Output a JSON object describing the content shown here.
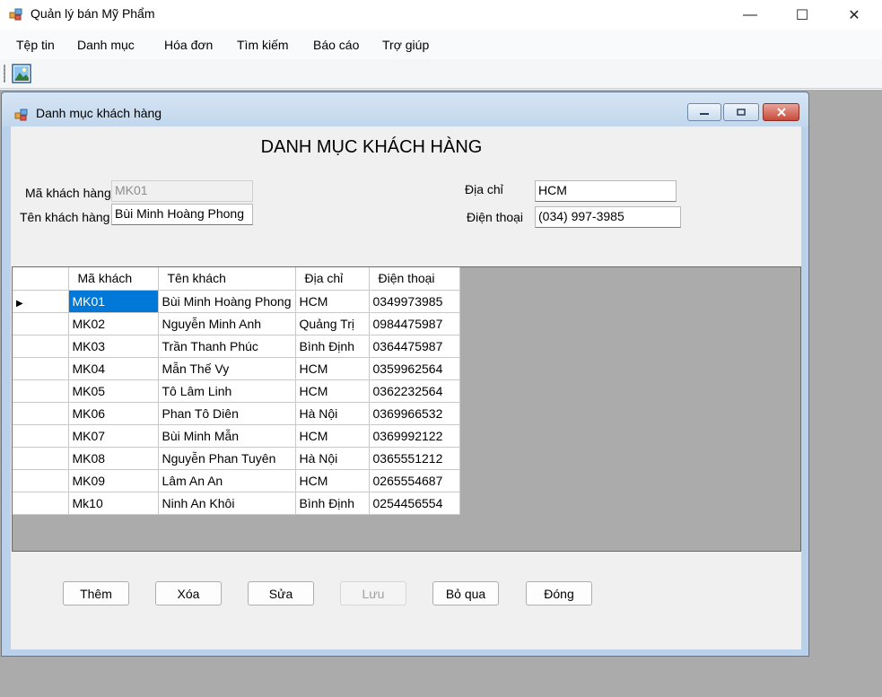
{
  "app": {
    "title": "Quản lý bán Mỹ Phẩm"
  },
  "window_controls": {
    "minimize": "—",
    "maximize": "☐",
    "close": "✕"
  },
  "menu": [
    "Tệp tin",
    "Danh mục",
    "Hóa đơn",
    "Tìm kiếm",
    "Báo cáo",
    "Trợ giúp"
  ],
  "toolbar": {
    "icons": [
      "picture-icon"
    ]
  },
  "child": {
    "title": "Danh mục khách hàng",
    "heading": "DANH MỤC KHÁCH HÀNG",
    "form": {
      "ma_label": "Mã khách hàng",
      "ma_value": "MK01",
      "ten_label": "Tên khách hàng",
      "ten_value": "Bùi Minh Hoàng Phong",
      "diachi_label": "Địa chỉ",
      "diachi_value": "HCM",
      "dienthoai_label": "Điện thoại",
      "dienthoai_value": "(034) 997-3985"
    },
    "grid": {
      "headers": [
        "Mã khách",
        "Tên khách",
        "Địa chỉ",
        "Điện thoại"
      ],
      "rows": [
        [
          "MK01",
          "Bùi Minh Hoàng Phong",
          "HCM",
          "0349973985"
        ],
        [
          "MK02",
          "Nguyễn Minh Anh",
          "Quảng Trị",
          "0984475987"
        ],
        [
          "MK03",
          "Trần Thanh Phúc",
          "Bình Định",
          "0364475987"
        ],
        [
          "MK04",
          "Mẫn Thế Vy",
          "HCM",
          "0359962564"
        ],
        [
          "MK05",
          "Tô Lâm Linh",
          "HCM",
          "0362232564"
        ],
        [
          "MK06",
          "Phan Tô Diên",
          "Hà Nội",
          "0369966532"
        ],
        [
          "MK07",
          "Bùi Minh Mẫn",
          "HCM",
          "0369992122"
        ],
        [
          "MK08",
          "Nguyễn Phan Tuyên",
          "Hà Nội",
          "0365551212"
        ],
        [
          "MK09",
          "Lâm An An",
          "HCM",
          "0265554687"
        ],
        [
          "Mk10",
          "Ninh An Khôi",
          "Bình Định",
          "0254456554"
        ]
      ],
      "current_row_marker": "▶"
    },
    "buttons": [
      "Thêm",
      "Xóa",
      "Sửa",
      "Lưu",
      "Bỏ qua",
      "Đóng"
    ],
    "disabled_buttons": [
      "Lưu"
    ]
  },
  "colors": {
    "selection": "#0078d7",
    "mdi_background": "#ababab",
    "child_frame": "#b9d1ea"
  }
}
